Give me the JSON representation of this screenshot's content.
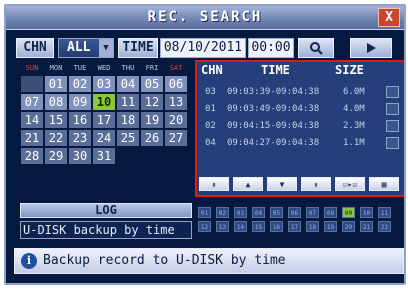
{
  "window": {
    "title": "REC. SEARCH",
    "close_label": "X"
  },
  "search": {
    "chn_label": "CHN",
    "chn_value": "ALL",
    "time_label": "TIME",
    "date_value": "08/10/2011",
    "time_value": "00:00",
    "search_icon": "search-icon",
    "play_icon": "play-icon"
  },
  "calendar": {
    "weekdays": [
      "SUN",
      "MON",
      "TUE",
      "WED",
      "THU",
      "FRI",
      "SAT"
    ],
    "days": [
      "",
      "01",
      "02",
      "03",
      "04",
      "05",
      "06",
      "07",
      "08",
      "09",
      "10",
      "11",
      "12",
      "13",
      "14",
      "15",
      "16",
      "17",
      "18",
      "19",
      "20",
      "21",
      "22",
      "23",
      "24",
      "25",
      "26",
      "27",
      "28",
      "29",
      "30",
      "31"
    ],
    "selected": "10"
  },
  "list": {
    "headers": {
      "chn": "CHN",
      "time": "TIME",
      "size": "SIZE"
    },
    "rows": [
      {
        "chn": "03",
        "time": "09:03:39-09:04:38",
        "size": "6.0M"
      },
      {
        "chn": "01",
        "time": "09:03:49-09:04:38",
        "size": "4.0M"
      },
      {
        "chn": "02",
        "time": "09:04:15-09:04:38",
        "size": "2.3M"
      },
      {
        "chn": "04",
        "time": "09:04:27-09:04:38",
        "size": "1.1M"
      }
    ],
    "controls": [
      "⇞",
      "▲",
      "▼",
      "⇟",
      "☑▸☑",
      "▦"
    ]
  },
  "log_label": "LOG",
  "backup_label": "U-DISK backup by time",
  "channels": {
    "row1": [
      "01",
      "02",
      "03",
      "04",
      "05",
      "06",
      "07",
      "08",
      "09",
      "10",
      "11"
    ],
    "row2": [
      "12",
      "13",
      "14",
      "15",
      "16",
      "17",
      "18",
      "19",
      "20",
      "21",
      "22"
    ],
    "active": "09"
  },
  "status": {
    "info_icon": "info-icon",
    "message": "Backup record to U-DISK by time"
  },
  "colors": {
    "selected_day": "#8cc63e",
    "highlight_border": "#e01818"
  }
}
